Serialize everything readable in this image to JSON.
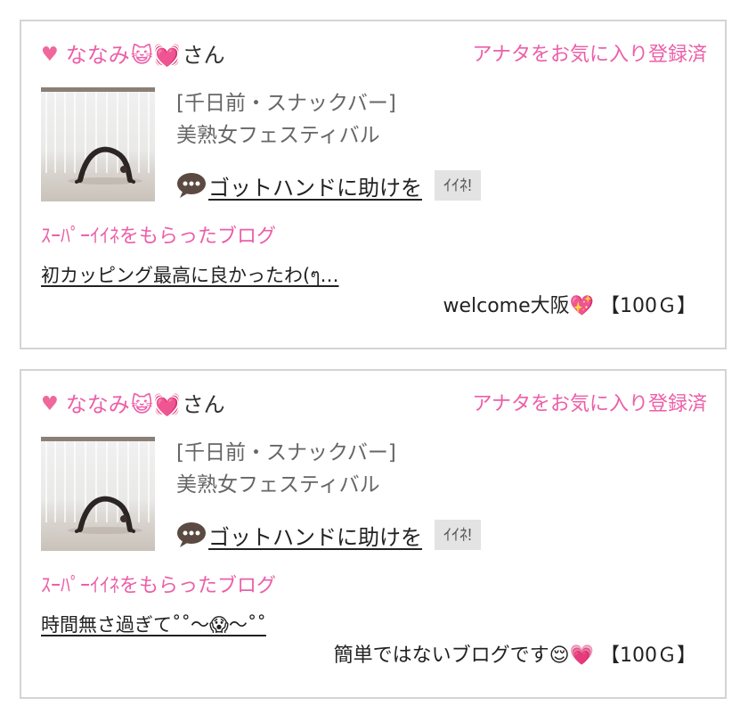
{
  "cards": [
    {
      "user": {
        "name": "ななみ",
        "emojis": [
          "😺",
          "💓"
        ],
        "suffix": "さん"
      },
      "favorite_status": "アナタをお気に入り登録済",
      "shop": {
        "location": "[千日前・スナックバー]",
        "name": "美熟女フェスティバル"
      },
      "headline": "ゴットハンドに助けを",
      "like_label": "ｲｲﾈ!",
      "super_like_label": "ｽｰﾊﾟｰｲｲﾈをもらったブログ",
      "blog_title": "初カッピング最高に良かったわ(ๆ…",
      "blog_summary": "welcome大阪💖 【100Ｇ】"
    },
    {
      "user": {
        "name": "ななみ",
        "emojis": [
          "😺",
          "💓"
        ],
        "suffix": "さん"
      },
      "favorite_status": "アナタをお気に入り登録済",
      "shop": {
        "location": "[千日前・スナックバー]",
        "name": "美熟女フェスティバル"
      },
      "headline": "ゴットハンドに助けを",
      "like_label": "ｲｲﾈ!",
      "super_like_label": "ｽｰﾊﾟｰｲｲﾈをもらったブログ",
      "blog_title": "時間無さ過ぎて˚˚〜😱〜˚˚",
      "blog_summary": "簡単ではないブログです😌💗 【100Ｇ】"
    }
  ],
  "icons": {
    "heart": "heart-icon",
    "speech": "speech-bubble-icon",
    "thumbnail": "yoga-photo"
  },
  "colors": {
    "accent_pink": "#ec5fa8",
    "heart": "#f0679c",
    "like_button_bg": "#e3e3e3",
    "card_border": "#d4d4d4"
  }
}
